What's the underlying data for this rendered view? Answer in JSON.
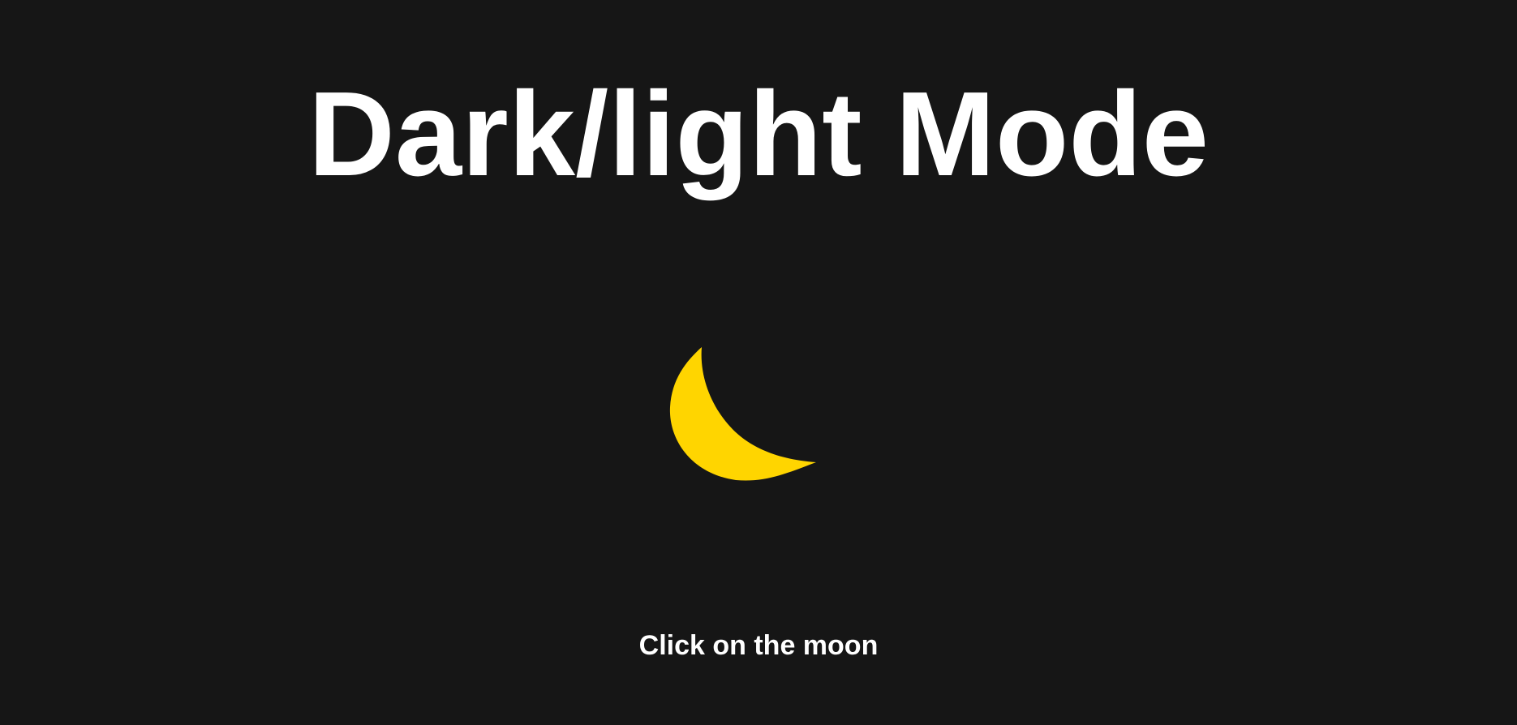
{
  "page": {
    "title": "Dark/light Mode",
    "hint": "Click on the moon",
    "theme": "dark"
  },
  "toggle": {
    "icon": "moon-icon",
    "icon_color": "#FFD500"
  },
  "colors": {
    "background": "#161616",
    "text": "#FFFFFF",
    "accent": "#FFD500"
  }
}
